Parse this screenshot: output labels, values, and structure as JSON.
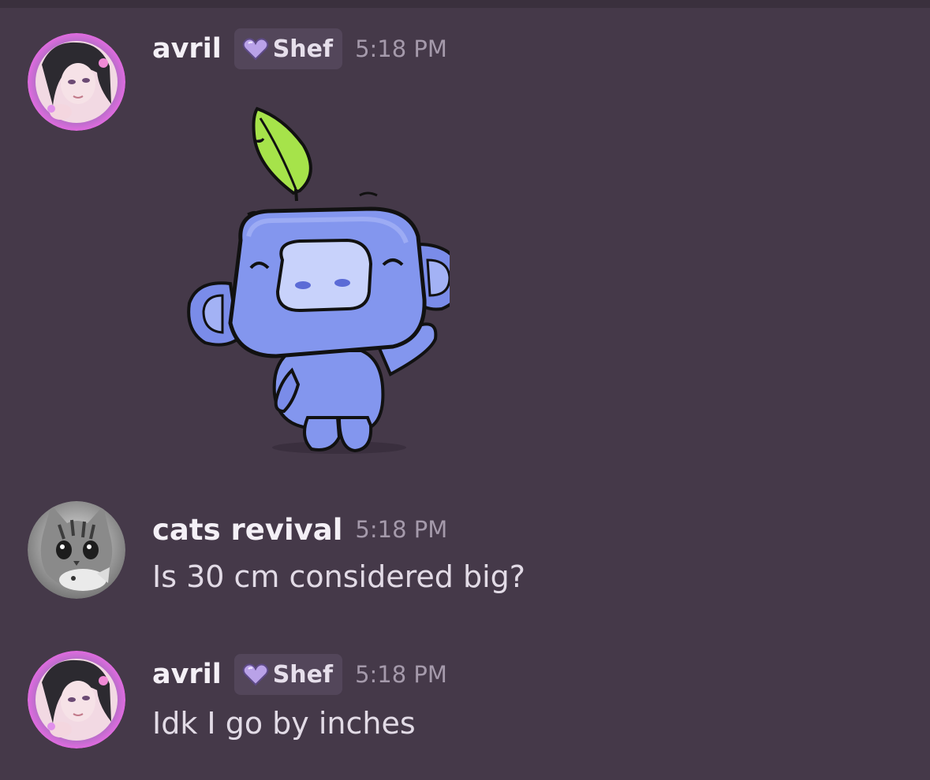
{
  "colors": {
    "background": "#453949",
    "tag_background": "#53465a",
    "username": "#f4f0f6",
    "timestamp": "#a59aab",
    "message_text": "#e2dbe6",
    "tag_heart": "#b9a2e8"
  },
  "messages": [
    {
      "author": "avril",
      "tag": "Shef",
      "tag_icon": "purple-heart-icon",
      "timestamp": "5:18 PM",
      "avatar": "anime-girl-avatar",
      "content": "",
      "sticker": "wumpus-waving-leaf-sticker"
    },
    {
      "author": "cats revival",
      "timestamp": "5:18 PM",
      "avatar": "cat-avatar",
      "content": "Is 30 cm considered big?"
    },
    {
      "author": "avril",
      "tag": "Shef",
      "tag_icon": "purple-heart-icon",
      "timestamp": "5:18 PM",
      "avatar": "anime-girl-avatar",
      "content": "Idk I go by inches"
    }
  ]
}
